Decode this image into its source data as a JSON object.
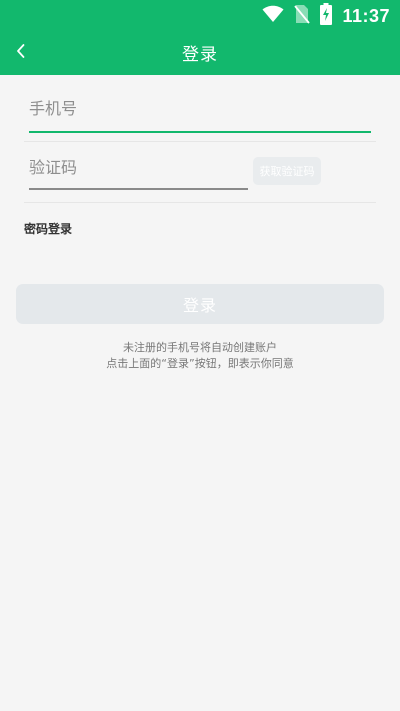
{
  "status_bar": {
    "time": "11:37",
    "icons": [
      "wifi-icon",
      "no-sim-icon",
      "battery-charging-icon"
    ]
  },
  "app_bar": {
    "title": "登录",
    "back_icon": "chevron-left-icon"
  },
  "form": {
    "phone_placeholder": "手机号",
    "phone_value": "",
    "code_placeholder": "验证码",
    "code_value": "",
    "get_code_label": "获取验证码"
  },
  "password_login_label": "密码登录",
  "login_button_label": "登录",
  "notice": {
    "line1": "未注册的手机号将自动创建账户",
    "line2": "点击上面的“登录”按钮，即表示你同意"
  },
  "colors": {
    "brand": "#12b86d",
    "background": "#f5f5f5",
    "disabled_button": "#e4e8eb"
  }
}
